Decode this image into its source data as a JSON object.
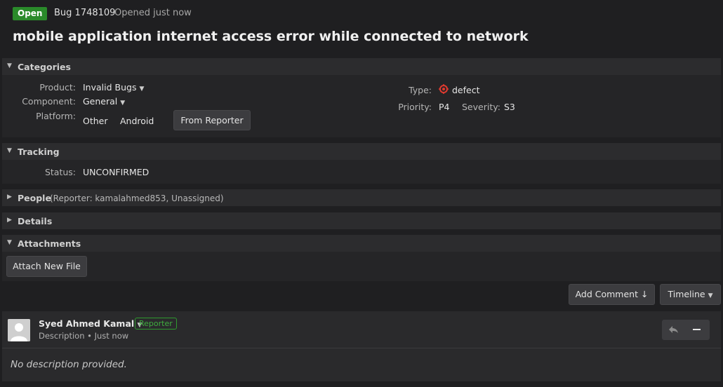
{
  "header": {
    "status": "Open",
    "bug_id": "Bug 1748109",
    "opened": "Opened just now",
    "title": "mobile application internet access error while connected to network"
  },
  "categories": {
    "heading": "Categories",
    "product_label": "Product:",
    "product_value": "Invalid Bugs",
    "component_label": "Component:",
    "component_value": "General",
    "platform_label": "Platform:",
    "platform_hw": "Other",
    "platform_os": "Android",
    "from_reporter": "From Reporter",
    "type_label": "Type:",
    "type_value": "defect",
    "priority_label": "Priority:",
    "priority_value": "P4",
    "severity_label": "Severity:",
    "severity_value": "S3"
  },
  "tracking": {
    "heading": "Tracking",
    "status_label": "Status:",
    "status_value": "UNCONFIRMED"
  },
  "people": {
    "heading": "People",
    "summary": "(Reporter: kamalahmed853, Unassigned)"
  },
  "details": {
    "heading": "Details"
  },
  "attachments": {
    "heading": "Attachments",
    "attach_button": "Attach New File"
  },
  "toolbar": {
    "add_comment": "Add Comment ↓",
    "timeline": "Timeline"
  },
  "comment": {
    "author": "Syed Ahmed Kamal",
    "role_badge": "Reporter",
    "meta": "Description • Just now",
    "body": "No description provided."
  },
  "colors": {
    "open_badge": "#2a8a2a",
    "reporter_badge": "#3fae3f",
    "defect_icon": "#e03a2f"
  },
  "icons": [
    "triangle-down-icon",
    "triangle-right-icon",
    "defect-icon",
    "reply-icon",
    "collapse-icon",
    "avatar-placeholder-icon"
  ]
}
